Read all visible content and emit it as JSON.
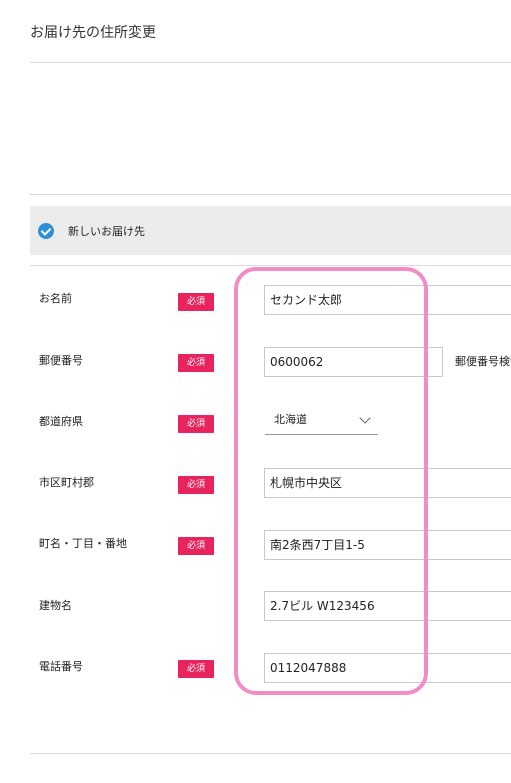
{
  "page": {
    "title": "お届け先の住所変更"
  },
  "section": {
    "label": "新しいお届け先",
    "checked": true,
    "accent_color": "#2f8fd8"
  },
  "required_badge": "必須",
  "badge_color": "#e8245e",
  "highlight_color": "#f28cc4",
  "fields": {
    "name": {
      "label": "お名前",
      "value": "セカンド太郎",
      "required": true
    },
    "postal": {
      "label": "郵便番号",
      "value": "0600062",
      "required": true,
      "search_label": "郵便番号検索"
    },
    "prefecture": {
      "label": "都道府県",
      "value": "北海道",
      "required": true
    },
    "city": {
      "label": "市区町村郡",
      "value": "札幌市中央区",
      "required": true
    },
    "street": {
      "label": "町名・丁目・番地",
      "value": "南2条西7丁目1-5",
      "required": true
    },
    "building": {
      "label": "建物名",
      "value": "2.7ビル W123456",
      "required": false
    },
    "phone": {
      "label": "電話番号",
      "value": "0112047888",
      "required": true
    }
  }
}
